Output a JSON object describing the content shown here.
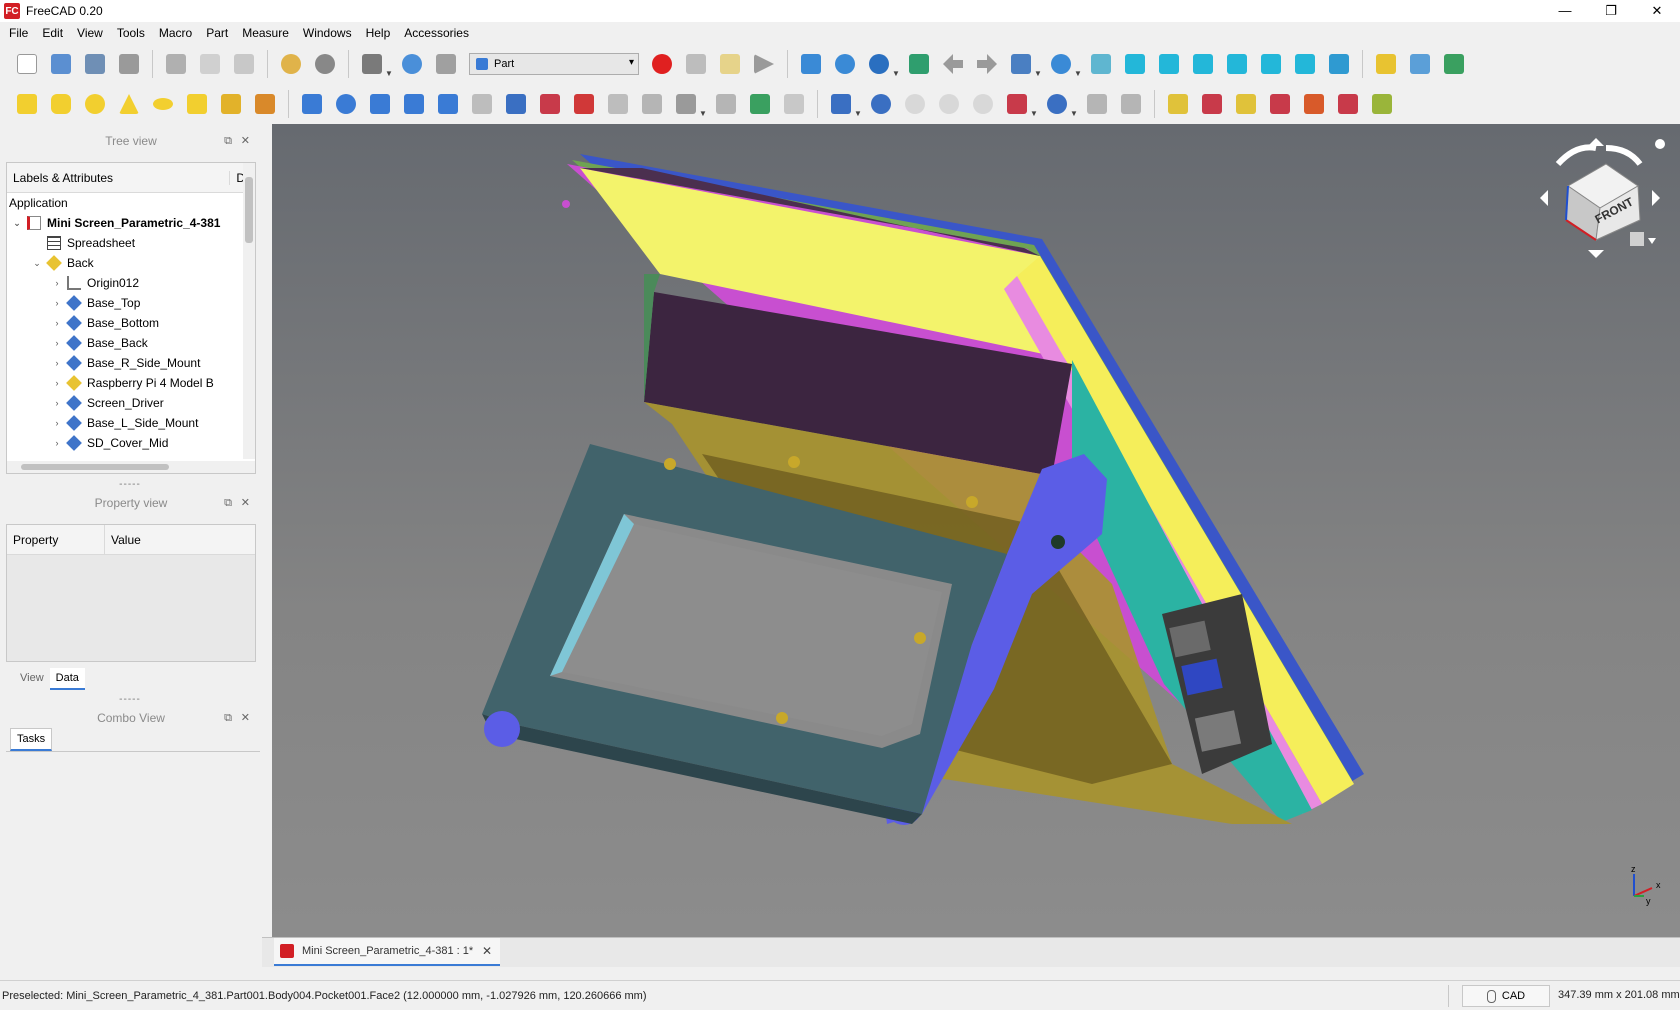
{
  "window": {
    "title": "FreeCAD 0.20",
    "logo": "FC",
    "controls": [
      "—",
      "❐",
      "✕"
    ]
  },
  "menu": [
    "File",
    "Edit",
    "View",
    "Tools",
    "Macro",
    "Part",
    "Measure",
    "Windows",
    "Help",
    "Accessories"
  ],
  "workbench": {
    "selected": "Part"
  },
  "tree_view": {
    "title": "Tree view",
    "column_labels": "Labels & Attributes",
    "column_desc": "D",
    "application": "Application",
    "document": "Mini Screen_Parametric_4-381",
    "items": [
      {
        "label": "Spreadsheet",
        "icon": "spreadsheet-icon"
      },
      {
        "label": "Back",
        "icon": "part-folder-icon"
      },
      {
        "label": "Origin012",
        "icon": "origin-icon"
      },
      {
        "label": "Base_Top",
        "icon": "body-icon"
      },
      {
        "label": "Base_Bottom",
        "icon": "body-icon"
      },
      {
        "label": "Base_Back",
        "icon": "body-icon"
      },
      {
        "label": "Base_R_Side_Mount",
        "icon": "body-icon"
      },
      {
        "label": "Raspberry Pi 4 Model B",
        "icon": "part-folder-icon"
      },
      {
        "label": "Screen_Driver",
        "icon": "body-icon"
      },
      {
        "label": "Base_L_Side_Mount",
        "icon": "body-icon"
      },
      {
        "label": "SD_Cover_Mid",
        "icon": "body-icon"
      }
    ]
  },
  "property_view": {
    "title": "Property view",
    "col_property": "Property",
    "col_value": "Value",
    "tabs": [
      "View",
      "Data"
    ],
    "active_tab": "Data"
  },
  "combo_view": {
    "title": "Combo View",
    "tab": "Tasks"
  },
  "document_tab": {
    "label": "Mini Screen_Parametric_4-381 : 1*"
  },
  "status": {
    "message": "Preselected: Mini_Screen_Parametric_4_381.Part001.Body004.Pocket001.Face2 (12.000000 mm, -1.027926 mm, 120.260666 mm)",
    "navigation": "CAD",
    "dimensions": "347.39 mm x 201.08 mm"
  },
  "navcube": {
    "face": "FRONT"
  },
  "axis": {
    "z": "z",
    "y": "y",
    "x": "x"
  },
  "colors": {
    "accent": "#3a7bd5",
    "face_yellow": "#f3f36b",
    "face_teal": "#2bb3a3",
    "face_blue": "#5b5de6",
    "face_slate": "#41636b",
    "face_purple": "#3c2540"
  }
}
